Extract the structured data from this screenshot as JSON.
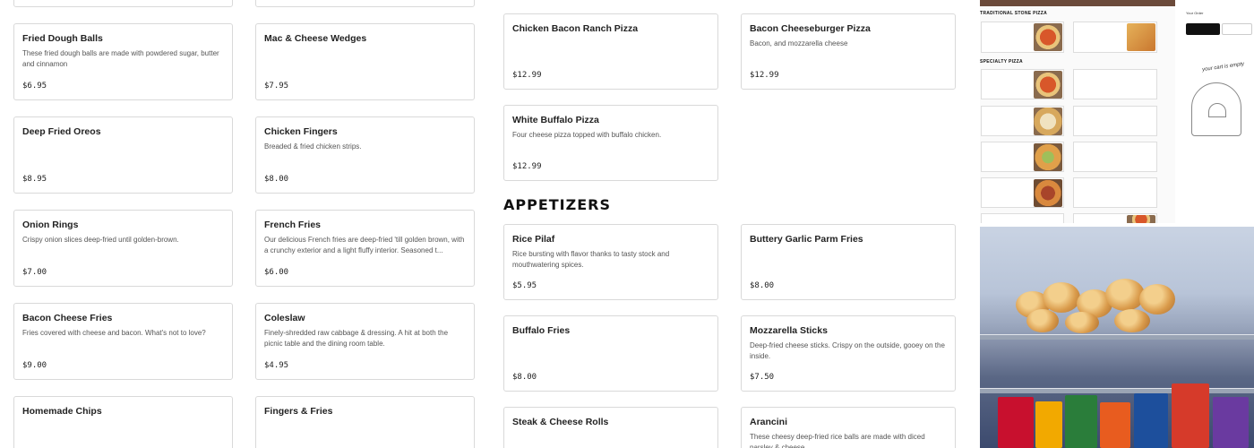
{
  "items": [
    {
      "name": "",
      "desc": "",
      "price": ""
    },
    {
      "name": "",
      "desc": "",
      "price": ""
    },
    {
      "name": "Fried Dough Balls",
      "desc": "These fried dough balls are made with powdered sugar, butter and cinnamon",
      "price": "$6.95"
    },
    {
      "name": "Mac & Cheese Wedges",
      "desc": "",
      "price": "$7.95"
    },
    {
      "name": "Deep Fried Oreos",
      "desc": "",
      "price": "$8.95"
    },
    {
      "name": "Chicken Fingers",
      "desc": "Breaded & fried chicken strips.",
      "price": "$8.00"
    },
    {
      "name": "Onion Rings",
      "desc": "Crispy onion slices deep-fried until golden-brown.",
      "price": "$7.00"
    },
    {
      "name": "French Fries",
      "desc": "Our delicious French fries are deep-fried 'till golden brown, with a crunchy exterior and a light fluffy interior. Seasoned t...",
      "price": "$6.00"
    },
    {
      "name": "Bacon Cheese Fries",
      "desc": "Fries covered with cheese and bacon. What's not to love?",
      "price": "$9.00"
    },
    {
      "name": "Coleslaw",
      "desc": "Finely-shredded raw cabbage & dressing. A hit at both the picnic table and the dining room table.",
      "price": "$4.95"
    },
    {
      "name": "Homemade Chips",
      "desc": "",
      "price": ""
    },
    {
      "name": "Fingers & Fries",
      "desc": "",
      "price": ""
    },
    {
      "name": "Chicken Bacon Ranch Pizza",
      "desc": "",
      "price": "$12.99"
    },
    {
      "name": "Bacon Cheeseburger Pizza",
      "desc": "Bacon, and mozzarella cheese",
      "price": "$12.99"
    },
    {
      "name": "White Buffalo Pizza",
      "desc": "Four cheese pizza topped with buffalo chicken.",
      "price": "$12.99"
    },
    {
      "name": "Rice Pilaf",
      "desc": "Rice bursting with flavor thanks to tasty stock and mouthwatering spices.",
      "price": "$5.95"
    },
    {
      "name": "Buttery Garlic Parm Fries",
      "desc": "",
      "price": "$8.00"
    },
    {
      "name": "Buffalo Fries",
      "desc": "",
      "price": "$8.00"
    },
    {
      "name": "Mozzarella Sticks",
      "desc": "Deep-fried cheese sticks. Crispy on the outside, gooey on the inside.",
      "price": "$7.50"
    },
    {
      "name": "Steak & Cheese Rolls",
      "desc": "",
      "price": ""
    },
    {
      "name": "Arancini",
      "desc": "These cheesy deep-fried rice balls are made with diced parsley & cheese.",
      "price": ""
    }
  ],
  "section": {
    "appetizers": "APPETIZERS"
  },
  "promo": {
    "traditional": "TRADITIONAL STONE PIZZA",
    "specialty": "SPECIALTY PIZZA",
    "your_order": "Your Order",
    "cart_empty": "your cart is empty"
  }
}
